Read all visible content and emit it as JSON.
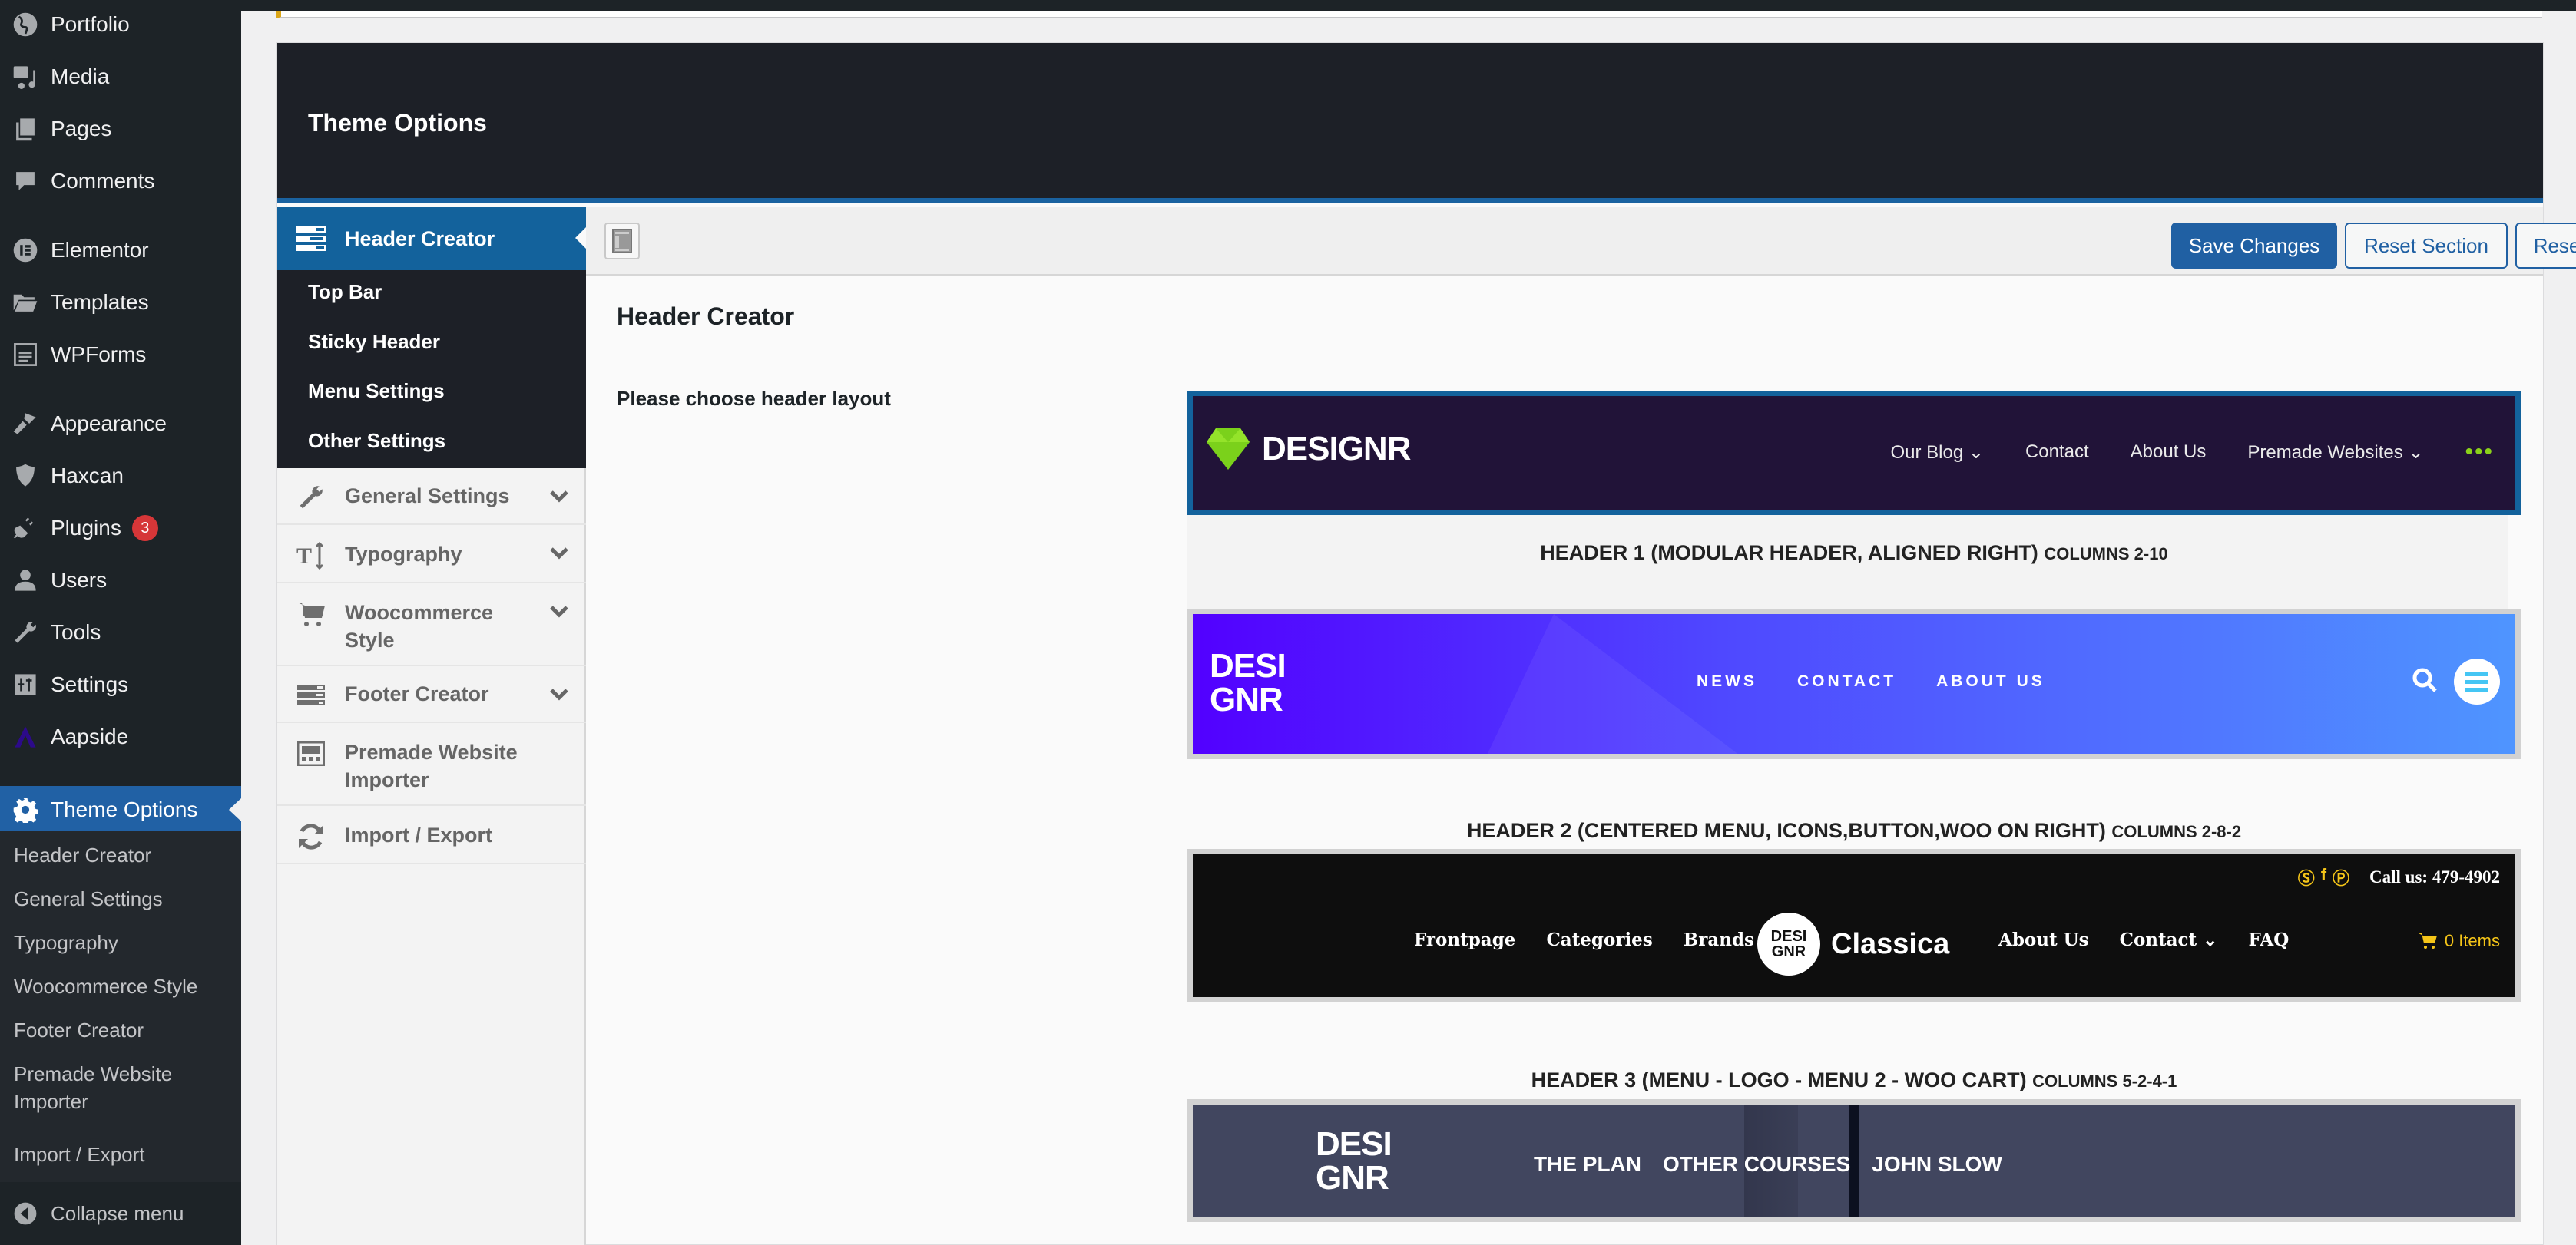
{
  "wp_admin_menu": {
    "items": [
      {
        "label": "Portfolio",
        "icon": "globe-icon"
      },
      {
        "label": "Media",
        "icon": "media-icon"
      },
      {
        "label": "Pages",
        "icon": "pages-icon"
      },
      {
        "label": "Comments",
        "icon": "comments-icon"
      },
      {
        "label": "Elementor",
        "icon": "elementor-icon"
      },
      {
        "label": "Templates",
        "icon": "folder-icon"
      },
      {
        "label": "WPForms",
        "icon": "wpforms-icon"
      },
      {
        "label": "Appearance",
        "icon": "paintbrush-icon"
      },
      {
        "label": "Haxcan",
        "icon": "shield-icon"
      },
      {
        "label": "Plugins",
        "icon": "plugin-icon",
        "badge": "3"
      },
      {
        "label": "Users",
        "icon": "user-icon"
      },
      {
        "label": "Tools",
        "icon": "wrench-icon"
      },
      {
        "label": "Settings",
        "icon": "settings-icon"
      },
      {
        "label": "Aapside",
        "icon": "aapside-icon"
      }
    ],
    "active": {
      "label": "Theme Options",
      "icon": "gear-icon"
    },
    "submenu": [
      "Header Creator",
      "General Settings",
      "Typography",
      "Woocommerce Style",
      "Footer Creator",
      "Premade Website Importer",
      "Import / Export"
    ],
    "collapse_label": "Collapse menu"
  },
  "panel": {
    "title": "Theme Options",
    "nav": {
      "active": {
        "label": "Header Creator",
        "icon": "header-layout-icon"
      },
      "subsections": [
        "Top Bar",
        "Sticky Header",
        "Menu Settings",
        "Other Settings"
      ],
      "items": [
        {
          "label": "General Settings",
          "icon": "wrench-icon",
          "expandable": true
        },
        {
          "label": "Typography",
          "icon": "text-height-icon",
          "expandable": true
        },
        {
          "label": "Woocommerce Style",
          "icon": "cart-icon",
          "expandable": true
        },
        {
          "label": "Footer Creator",
          "icon": "footer-layout-icon",
          "expandable": true
        },
        {
          "label": "Premade Website Importer",
          "icon": "website-icon",
          "expandable": false
        },
        {
          "label": "Import / Export",
          "icon": "refresh-icon",
          "expandable": false
        }
      ]
    },
    "toolbar": {
      "save_label": "Save Changes",
      "reset_section_label": "Reset Section",
      "reset_all_label": "Reset All"
    },
    "section_title": "Header Creator",
    "field_label": "Please choose header layout",
    "colors": {
      "accent": "#13629c",
      "button": "#2060a3",
      "header_bg": "#1d2027"
    }
  },
  "layouts": [
    {
      "selected": true,
      "caption": "HEADER 1 (MODULAR HEADER, ALIGNED RIGHT)",
      "columns": "COLUMNS 2-10",
      "logo": "DESIGNR",
      "menu": [
        "Our Blog ⌄",
        "Contact",
        "About Us",
        "Premade Websites ⌄"
      ],
      "more": "•••"
    },
    {
      "selected": false,
      "caption": "HEADER 2 (CENTERED MENU, ICONS,BUTTON,WOO ON RIGHT)",
      "columns": "COLUMNS 2-8-2",
      "logo_line1": "DESI",
      "logo_line2": "GNR",
      "menu": [
        "NEWS",
        "CONTACT",
        "ABOUT US"
      ]
    },
    {
      "selected": false,
      "caption": "HEADER 3 (MENU - LOGO - MENU 2 - WOO CART)",
      "columns": "COLUMNS 5-2-4-1",
      "topbar_call": "Call us: 479-4902",
      "menu_left": [
        "Frontpage",
        "Categories",
        "Brands"
      ],
      "logo_circle_line1": "DESI",
      "logo_circle_line2": "GNR",
      "logo_text": "Classica",
      "menu_right": [
        "About Us",
        "Contact ⌄",
        "FAQ"
      ],
      "cart": "0 Items"
    },
    {
      "selected": false,
      "logo_line1": "DESI",
      "logo_line2": "GNR",
      "menu": [
        "THE PLAN",
        "OTHER COURSES",
        "JOHN SLOW"
      ]
    }
  ]
}
